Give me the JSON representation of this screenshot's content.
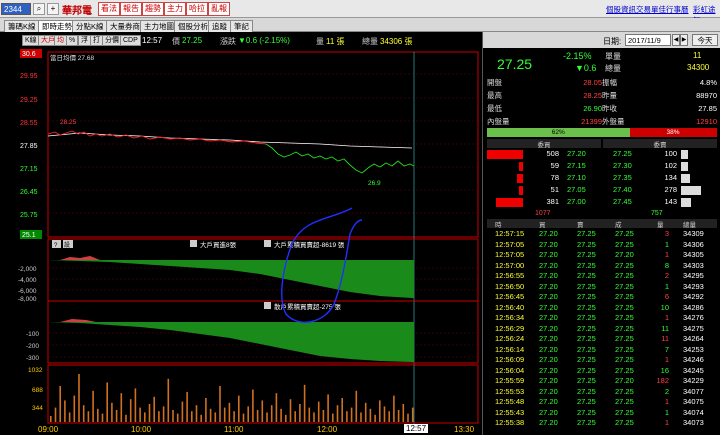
{
  "toolbar": {
    "code": "2344",
    "stock_name": "華邦電",
    "buttons": [
      "看法",
      "報告",
      "趨勢",
      "主力",
      "哈拉",
      "亂報"
    ],
    "links": [
      "個股資訊",
      "交易單佳",
      "行事曆",
      "彩虹途知"
    ]
  },
  "tabs": [
    "籌碼K線",
    "即時走勢",
    "分點K線",
    "大量券商",
    "主力地圖",
    "個股分析",
    "追蹤",
    "筆記"
  ],
  "chart_toolbar": {
    "buttons": [
      "K線",
      "大戶",
      "均",
      "%",
      "浮",
      "打",
      "分價",
      "CDP"
    ],
    "time": "12:57",
    "price_label": "價",
    "price": "27.25",
    "change_label": "漲跌",
    "change": "▼0.6 (-2.15%)",
    "vol_label": "量",
    "vol": "11 張",
    "total_label": "總量",
    "total": "34306 張"
  },
  "chart": {
    "avg_label": "當日均價 27.68",
    "y_ticks": [
      "30.6",
      "29.95",
      "29.25",
      "28.55",
      "27.85",
      "27.15",
      "26.45",
      "25.75",
      "25.1"
    ],
    "high_mark": "28.25",
    "low_mark": "26.9",
    "indicator1_ticks": [
      "-2,000",
      "-4,000",
      "-6,000",
      "-8,000"
    ],
    "indicator2_ticks": [
      "-100",
      "-200",
      "-300"
    ],
    "volume_ticks": [
      "1032",
      "688",
      "344"
    ],
    "x_ticks": [
      "09:00",
      "10:00",
      "11:00",
      "12:00",
      "13:30"
    ],
    "cursor_time": "12:57",
    "panel1_controls": [
      "?",
      "設"
    ],
    "panel1_legend1": "大戶買進8張",
    "panel1_legend2": "大戶累積買賣超-8619 張",
    "panel2_legend": "散戶累積買賣超-275 張"
  },
  "right": {
    "date_label": "日期:",
    "date": "2017/11/9",
    "today_btn": "今天",
    "price": "27.25",
    "pct": "-2.15%",
    "change": "▼0.6",
    "single_label": "單量",
    "single": "11",
    "total_label": "總量",
    "total": "34300",
    "stats": [
      [
        "開盤",
        "28.05",
        "振幅",
        "4.8%"
      ],
      [
        "最高",
        "28.25",
        "昨量",
        "88970"
      ],
      [
        "最低",
        "26.90",
        "昨收",
        "27.85"
      ],
      [
        "內盤量",
        "21399",
        "外盤量",
        "12910"
      ]
    ],
    "ratio_in": "62%",
    "ratio_out": "38%",
    "ratio_in_value": 62,
    "book_headers": [
      "委買",
      "委賣"
    ],
    "book": [
      [
        "508",
        "27.20",
        "27.25",
        "100"
      ],
      [
        "59",
        "27.15",
        "27.30",
        "102"
      ],
      [
        "78",
        "27.10",
        "27.35",
        "134"
      ],
      [
        "51",
        "27.05",
        "27.40",
        "278"
      ],
      [
        "381",
        "27.00",
        "27.45",
        "143"
      ]
    ],
    "book_totals": [
      "1077",
      "757"
    ],
    "ticks_headers": [
      "時",
      "買",
      "賣",
      "成",
      "量",
      "總量"
    ],
    "ticks": [
      [
        "12:57:15",
        "27.20",
        "27.25",
        "27.25",
        "3",
        "34309"
      ],
      [
        "12:57:05",
        "27.20",
        "27.25",
        "27.25",
        "1",
        "34306"
      ],
      [
        "12:57:05",
        "27.20",
        "27.25",
        "27.20",
        "1",
        "34305"
      ],
      [
        "12:57:00",
        "27.20",
        "27.25",
        "27.25",
        "8",
        "34303"
      ],
      [
        "12:56:55",
        "27.20",
        "27.25",
        "27.25",
        "2",
        "34295"
      ],
      [
        "12:56:50",
        "27.20",
        "27.25",
        "27.25",
        "1",
        "34293"
      ],
      [
        "12:56:45",
        "27.20",
        "27.25",
        "27.25",
        "6",
        "34292"
      ],
      [
        "12:56:40",
        "27.20",
        "27.25",
        "27.25",
        "10",
        "34286"
      ],
      [
        "12:56:34",
        "27.20",
        "27.25",
        "27.25",
        "1",
        "34276"
      ],
      [
        "12:56:29",
        "27.20",
        "27.25",
        "27.25",
        "11",
        "34275"
      ],
      [
        "12:56:24",
        "27.20",
        "27.25",
        "27.25",
        "11",
        "34264"
      ],
      [
        "12:56:14",
        "27.20",
        "27.25",
        "27.25",
        "7",
        "34253"
      ],
      [
        "12:56:09",
        "27.20",
        "27.25",
        "27.25",
        "1",
        "34246"
      ],
      [
        "12:56:04",
        "27.20",
        "27.25",
        "27.25",
        "16",
        "34245"
      ],
      [
        "12:55:59",
        "27.20",
        "27.25",
        "27.20",
        "182",
        "34229"
      ],
      [
        "12:55:53",
        "27.20",
        "27.25",
        "27.25",
        "2",
        "34077"
      ],
      [
        "12:55:48",
        "27.20",
        "27.25",
        "27.25",
        "1",
        "34075"
      ],
      [
        "12:55:43",
        "27.20",
        "27.25",
        "27.25",
        "1",
        "34074"
      ],
      [
        "12:55:38",
        "27.20",
        "27.25",
        "27.25",
        "1",
        "34073"
      ]
    ]
  }
}
